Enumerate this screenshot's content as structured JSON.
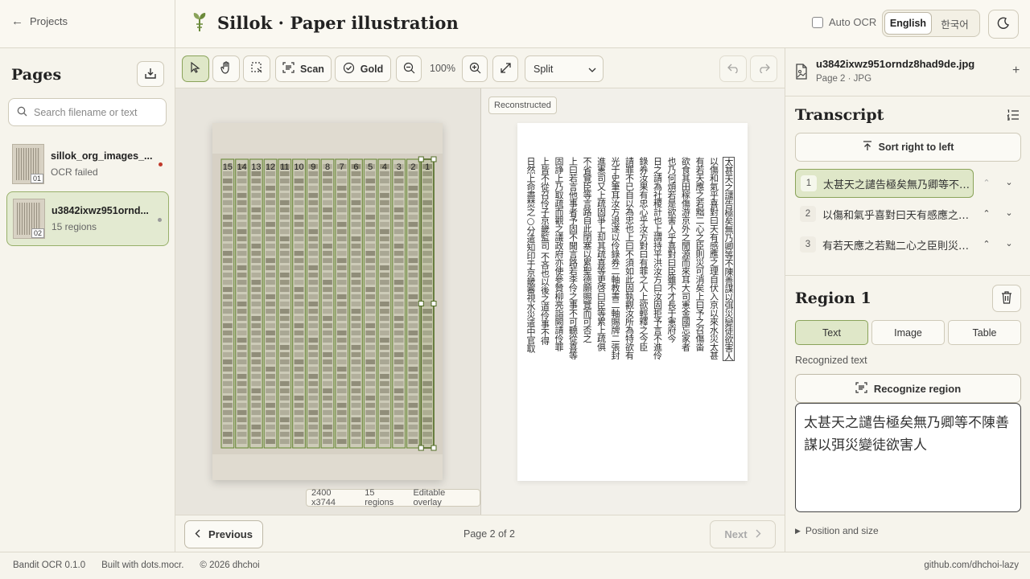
{
  "header": {
    "back_label": "Projects",
    "title": "Sillok · Paper illustration",
    "auto_ocr_label": "Auto OCR",
    "auto_ocr_checked": false,
    "languages": [
      "English",
      "한국어"
    ],
    "active_language": "English"
  },
  "sidebar": {
    "title": "Pages",
    "search_placeholder": "Search filename or text",
    "pages": [
      {
        "name": "sillok_org_images_...",
        "status": "OCR failed",
        "index": "01",
        "dot_color": "#c0392b",
        "active": false
      },
      {
        "name": "u3842ixwz951ornd...",
        "status": "15 regions",
        "index": "02",
        "dot_color": "#9a9a9a",
        "active": true
      }
    ]
  },
  "toolbar": {
    "scan_label": "Scan",
    "gold_label": "Gold",
    "zoom": "100%",
    "view_mode": "Split",
    "active_tool": "select"
  },
  "canvas": {
    "image_size": "2400 x3744",
    "region_count": "15 regions",
    "overlay_label": "Editable overlay",
    "reconstructed_label": "Reconstructed",
    "region_labels": [
      "15",
      "14",
      "13",
      "12",
      "11",
      "10",
      "9",
      "8",
      "7",
      "6",
      "5",
      "4",
      "3",
      "2",
      "1"
    ],
    "reconstructed_columns": [
      "太甚天之譴告極矣無乃卿等不陳善謀以弭災變徒欲害人",
      "以傷和氣乎喜對曰天有感應之理自伏入京以來水災太甚",
      "有若天應之若黜二心之臣則災可消矣上曰予之召傷畓",
      "欲食其田稼傷游京外之閒源而來耳大司憲金國忘家者",
      "也乃何煩若是欲害人乎喜對曰臣雖不才長于憲府今",
      "日之請為社稷計也上謂持平洪汝方曰汝固拒予言不進伶",
      "錄券汝果有忠心乎汝方對曰有罪之人上欲輕釋之今臣",
      "請罪不已自以為忠也上曰不須如此固執觀汝所為特欲有",
      "光于史筆耳汝方退遂以伶錄券二軸教書二軸賜牌二張封",
      "進憲司又上疏固爭上却其疏喜等更啓曰臣等累上疏俱",
      "不省覽臣等言路自此閉塞以累聖德願賜覽而可否之",
      "上曰若言他事者予固不聞言路若李伶之事不可聽從喜等",
      "固諍上乃取疏而觀之議政府亦使參贊柳亮詣闕請伶罪",
      "上皆不從召伶子京畿監司 不吝也以後之道伶事不得",
      "日然上命盡焚之○分遣知印于京畿審視水災遣中官取"
    ]
  },
  "pager": {
    "prev_label": "Previous",
    "page_indicator": "Page 2 of 2",
    "next_label": "Next"
  },
  "right_panel": {
    "file_name": "u3842ixwz951orndz8had9de.jpg",
    "file_sub": "Page 2 · JPG",
    "transcript_title": "Transcript",
    "sort_label": "Sort right to left",
    "lines": [
      {
        "num": "1",
        "text": "太甚天之譴告極矣無乃卿等不陳善謀以弭災變徒欲害人"
      },
      {
        "num": "2",
        "text": "以傷和氣乎喜對曰天有感應之理自伏入京以來水災太甚"
      },
      {
        "num": "3",
        "text": "有若天應之若黜二心之臣則災可消矣上曰予之召傷畓"
      }
    ],
    "region_title": "Region 1",
    "region_tabs": [
      "Text",
      "Image",
      "Table"
    ],
    "active_tab": "Text",
    "recognized_label": "Recognized text",
    "recognize_button": "Recognize region",
    "recognized_text": "太甚天之譴告極矣無乃卿等不陳善謀以弭災變徒欲害人",
    "position_label": "Position and size"
  },
  "footer": {
    "version": "Bandit OCR 0.1.0",
    "built_with": "Built with dots.mocr.",
    "copyright": "© 2026 dhchoi",
    "github": "github.com/dhchoi-lazy"
  },
  "colors": {
    "accent": "#8aa35a",
    "accent_bg": "#dfe7c8",
    "background": "#f6f4ec",
    "error_dot": "#c0392b"
  }
}
